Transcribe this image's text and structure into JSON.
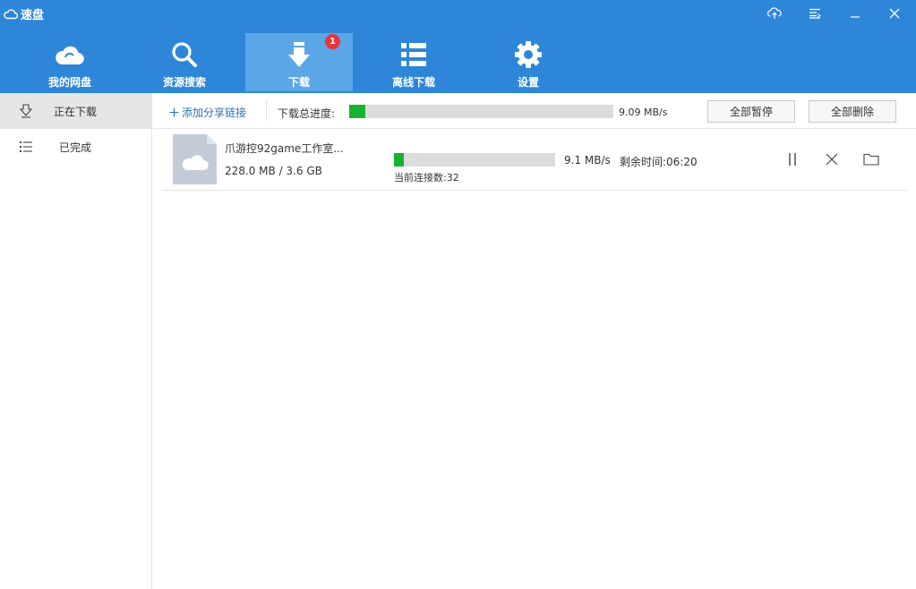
{
  "app": {
    "title": "速盘"
  },
  "window_controls": [
    {
      "name": "upload-transfer-icon"
    },
    {
      "name": "menu-icon"
    },
    {
      "name": "minimize-icon"
    },
    {
      "name": "close-icon"
    }
  ],
  "nav": {
    "items": [
      {
        "label": "我的网盘",
        "icon": "cloud-icon",
        "active": false
      },
      {
        "label": "资源搜索",
        "icon": "search-icon",
        "active": false
      },
      {
        "label": "下载",
        "icon": "download-arrow-icon",
        "active": true,
        "badge": "1"
      },
      {
        "label": "离线下载",
        "icon": "list-icon",
        "active": false
      },
      {
        "label": "设置",
        "icon": "gear-icon",
        "active": false
      }
    ]
  },
  "sidebar": {
    "items": [
      {
        "label": "正在下载",
        "icon": "download-icon",
        "active": true
      },
      {
        "label": "已完成",
        "icon": "list-icon",
        "active": false
      }
    ]
  },
  "toolbar": {
    "add_link_label": "添加分享链接",
    "total_label": "下载总进度:",
    "total_progress": 0.06,
    "total_speed": "9.09 MB/s",
    "pause_all_label": "全部暂停",
    "delete_all_label": "全部删除"
  },
  "task": {
    "name": "爪游控92game工作室...",
    "size": "228.0 MB / 3.6 GB",
    "progress": 0.06,
    "speed": "9.1 MB/s",
    "remaining": "剩余时间:06:20",
    "connections": "当前连接数:32"
  },
  "colors": {
    "header_bg": "#2e86d8",
    "nav_active_bg": "#5aa6e6",
    "progress_fill": "#17b330",
    "badge": "#e9353a",
    "link": "#2c6fb8"
  }
}
